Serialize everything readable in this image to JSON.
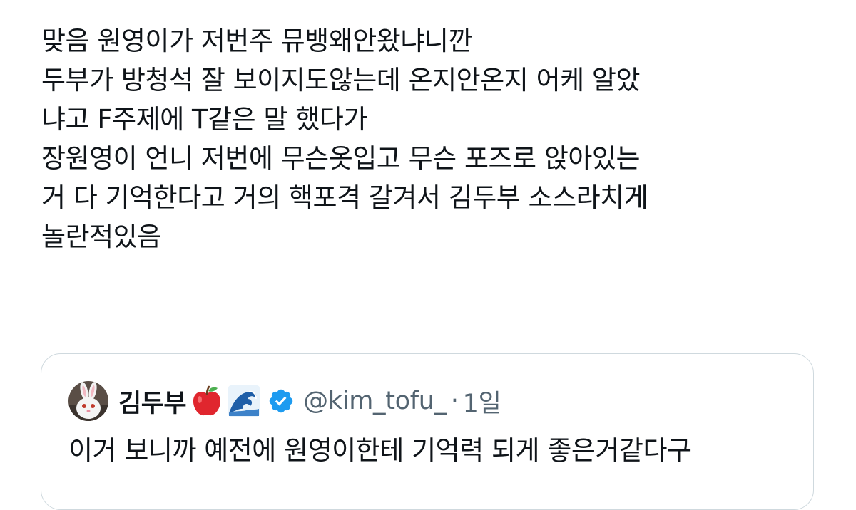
{
  "tweet": {
    "lines": [
      "맞음 원영이가 저번주 뮤뱅왜안왔냐니깐",
      "두부가 방청석 잘 보이지도않는데 온지안온지 어케 알았",
      "냐고 F주제에 T같은 말 했다가",
      "장원영이 언니 저번에 무슨옷입고 무슨 포즈로 앉아있는",
      "거 다 기억한다고 거의 핵포격 갈겨서 김두부 소스라치게",
      "놀란적있음"
    ]
  },
  "quote": {
    "display_name": "김두부",
    "emoji_icons": [
      "red-apple-icon",
      "water-wave-icon"
    ],
    "handle": "@kim_tofu_",
    "separator": "·",
    "time": "1일",
    "text": "이거 보니까 예전에 원영이한테 기억력 되게 좋은거같다구",
    "colors": {
      "verified": "#1d9bf0",
      "secondary_text": "#536471",
      "border": "#cfd9de"
    }
  }
}
